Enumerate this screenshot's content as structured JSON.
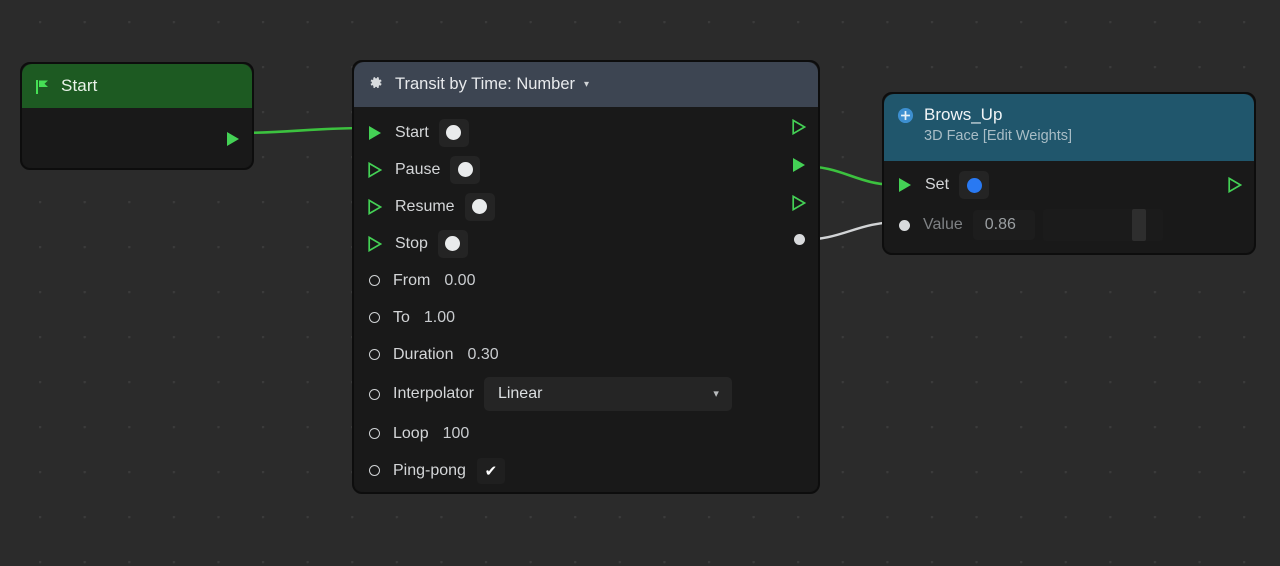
{
  "canvas": {
    "background_color": "#2b2b2b",
    "grid_dot_color": "#3b3b3b"
  },
  "colors": {
    "exec_green": "#44d155",
    "wire_green": "#3cc23f",
    "wire_grey": "#d2d4d6",
    "start_header": "#1d5a22",
    "transit_header": "#3d4552",
    "brows_header": "#20566c",
    "node_body": "#191919",
    "data_blue": "#2979f2"
  },
  "nodes": {
    "start": {
      "title": "Start",
      "icon": "flag-icon",
      "outputs": [
        {
          "name": "exec-out",
          "type": "exec",
          "connected": true
        }
      ]
    },
    "transit": {
      "title": "Transit by Time: Number",
      "icon": "gear-icon",
      "caret": "▾",
      "exec_rows": [
        {
          "label": "Start",
          "connected": true,
          "widget": "dot"
        },
        {
          "label": "Pause",
          "connected": false,
          "widget": "dot"
        },
        {
          "label": "Resume",
          "connected": false,
          "widget": "dot"
        },
        {
          "label": "Stop",
          "connected": false,
          "widget": "dot"
        }
      ],
      "param_rows": [
        {
          "label": "From",
          "widget": "number",
          "value": "0.00"
        },
        {
          "label": "To",
          "widget": "number",
          "value": "1.00"
        },
        {
          "label": "Duration",
          "widget": "number",
          "value": "0.30"
        },
        {
          "label": "Interpolator",
          "widget": "select",
          "value": "Linear"
        },
        {
          "label": "Loop",
          "widget": "number",
          "value": "100"
        },
        {
          "label": "Ping-pong",
          "widget": "checkbox",
          "value": "✔"
        }
      ],
      "outputs": [
        {
          "name": "exec-out-1",
          "type": "exec",
          "connected": false
        },
        {
          "name": "exec-out-2",
          "type": "exec",
          "connected": true
        },
        {
          "name": "exec-out-3",
          "type": "exec",
          "connected": false
        },
        {
          "name": "value-out",
          "type": "data",
          "connected": true
        }
      ]
    },
    "brows": {
      "title": "Brows_Up",
      "subtitle": "3D Face [Edit Weights]",
      "icon": "plus-circle-icon",
      "rows": [
        {
          "label": "Set",
          "type": "exec",
          "connected": true,
          "widget": "dot-blue"
        },
        {
          "label": "Value",
          "type": "data",
          "connected": true,
          "widget": "slider",
          "value": "0.86",
          "slider_percent": 86
        }
      ],
      "outputs": [
        {
          "name": "exec-out",
          "type": "exec",
          "connected": false
        }
      ]
    }
  }
}
